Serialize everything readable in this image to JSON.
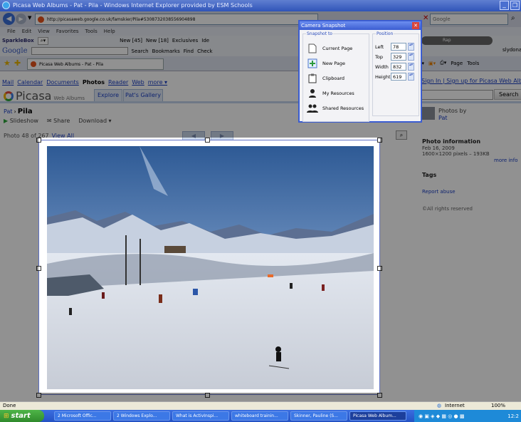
{
  "window": {
    "title": "Picasa Web Albums - Pat - Pila - Windows Internet Explorer provided by ESM Schools"
  },
  "address": {
    "url": "http://picasaweb.google.co.uk/famskier/Pila#5308732038556904898"
  },
  "search_box": {
    "placeholder": "Google"
  },
  "menubar": {
    "items": [
      "File",
      "Edit",
      "View",
      "Favorites",
      "Tools",
      "Help"
    ]
  },
  "toolbar1": {
    "brand": "SparkleBox",
    "items": [
      "New [45]",
      "New [18]",
      "Exclusives",
      "Ide"
    ]
  },
  "google_bar": {
    "brand": "Google",
    "search": "Search",
    "bookmarks": "Bookmarks",
    "find": "Find",
    "check": "Check",
    "user": "slydonald"
  },
  "player": {
    "label": "Rap"
  },
  "ie_tab": {
    "label": "Picasa Web Albums - Pat - Pila"
  },
  "ie_cmd": {
    "page": "Page",
    "tools": "Tools"
  },
  "gnav": {
    "items": [
      "Mail",
      "Calendar",
      "Documents",
      "Photos",
      "Reader",
      "Web",
      "more ▾"
    ],
    "signin": "Sign In | Sign up for Picasa Web Albums"
  },
  "picasa": {
    "logo": "Picasa",
    "logo_sub": "Web Albums",
    "tabs": [
      "Explore",
      "Pat's Gallery"
    ],
    "search_button": "Search",
    "breadcrumb_owner": "Pat",
    "breadcrumb_sep": "›",
    "album_title": "Pila",
    "actions": [
      "Slideshow",
      "Share",
      "Download ▾"
    ],
    "photo_counter": "Photo 48 of 267",
    "view_all": "View All"
  },
  "sidebar": {
    "photos_by": "Photos by",
    "owner": "Pat",
    "info_heading": "Photo information",
    "date": "Feb 16, 2009",
    "size": "1600×1200 pixels – 193KB",
    "more_info": "more info",
    "tags_heading": "Tags",
    "report": "Report abuse",
    "rights": "©All rights reserved"
  },
  "snapshot": {
    "title": "Camera Snapshot",
    "snapshot_to": "Snapshot to",
    "options": [
      {
        "label": "Current Page",
        "icon": "page-icon"
      },
      {
        "label": "New Page",
        "icon": "new-page-icon"
      },
      {
        "label": "Clipboard",
        "icon": "clipboard-icon"
      },
      {
        "label": "My Resources",
        "icon": "person-icon"
      },
      {
        "label": "Shared Resources",
        "icon": "group-icon"
      }
    ],
    "position_label": "Position",
    "fields": [
      {
        "label": "Left",
        "value": "78"
      },
      {
        "label": "Top",
        "value": "329"
      },
      {
        "label": "Width",
        "value": "832"
      },
      {
        "label": "Height",
        "value": "619"
      }
    ]
  },
  "statusbar": {
    "status": "Done",
    "zone": "Internet",
    "zoom": "100%"
  },
  "taskbar": {
    "start": "start",
    "items": [
      "2 Microsoft Offic...",
      "2 Windows Explo...",
      "What is ActivInspi...",
      "whiteboard trainin...",
      "Skinner, Pauline (S...",
      "Picasa Web Album..."
    ],
    "clock": "12:2"
  }
}
